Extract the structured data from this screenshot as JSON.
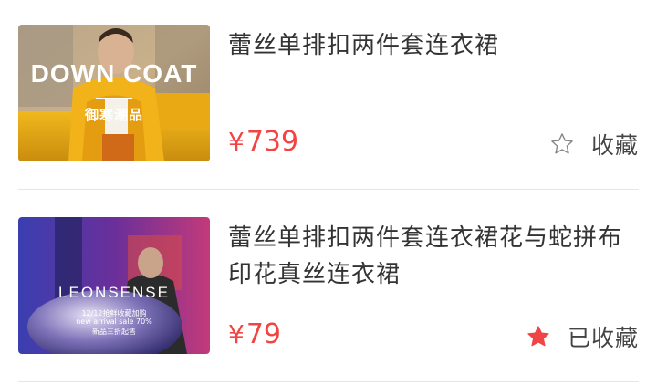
{
  "products": [
    {
      "title": "蕾丝单排扣两件套连衣裙",
      "currency": "¥",
      "price": "739",
      "favorite_label": "收藏",
      "favorite_icon": "star-outline-icon",
      "image": {
        "headline": "DOWN COAT",
        "subline": "御寒潮品"
      }
    },
    {
      "title": "蕾丝单排扣两件套连衣裙花与蛇拼布印花真丝连衣裙",
      "currency": "¥",
      "price": "79",
      "favorite_label": "已收藏",
      "favorite_icon": "star-filled-icon",
      "image": {
        "brand": "LEONSENSE",
        "line1": "12/12抢鲜收藏加购",
        "line2": "new arrival sale 70%",
        "line3": "新品三折起售"
      }
    }
  ],
  "colors": {
    "price": "#f34444",
    "star_filled": "#f04545",
    "text": "#333333",
    "divider": "#e6e6e6"
  }
}
